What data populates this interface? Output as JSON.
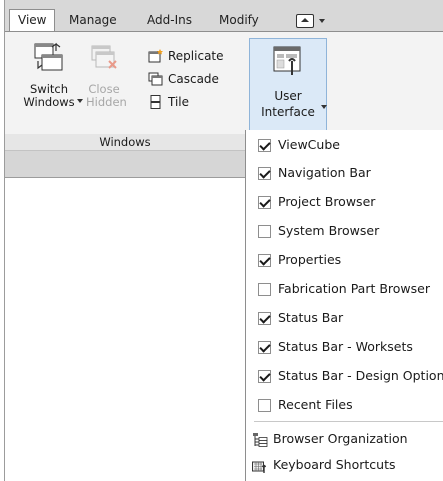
{
  "tabs": [
    {
      "label": "View",
      "active": true
    },
    {
      "label": "Manage",
      "active": false
    },
    {
      "label": "Add-Ins",
      "active": false
    },
    {
      "label": "Modify",
      "active": false
    }
  ],
  "windows_panel": {
    "title": "Windows",
    "switch_windows": {
      "line1": "Switch",
      "line2": "Windows",
      "icon": "switch-windows-icon",
      "has_dropdown": true
    },
    "close_hidden": {
      "line1": "Close",
      "line2": "Hidden",
      "icon": "close-hidden-icon",
      "enabled": false
    },
    "small_buttons": [
      {
        "label": "Replicate",
        "icon": "replicate-icon"
      },
      {
        "label": "Cascade",
        "icon": "cascade-icon"
      },
      {
        "label": "Tile",
        "icon": "tile-icon"
      }
    ]
  },
  "user_interface": {
    "line1": "User",
    "line2": "Interface",
    "icon": "user-interface-icon",
    "has_dropdown": true
  },
  "menu": {
    "toggles": [
      {
        "label": "ViewCube",
        "checked": true
      },
      {
        "label": "Navigation Bar",
        "checked": true
      },
      {
        "label": "Project Browser",
        "checked": true
      },
      {
        "label": "System Browser",
        "checked": false
      },
      {
        "label": "Properties",
        "checked": true
      },
      {
        "label": "Fabrication Part Browser",
        "checked": false
      },
      {
        "label": "Status Bar",
        "checked": true
      },
      {
        "label": "Status Bar - Worksets",
        "checked": true
      },
      {
        "label": "Status Bar - Design Options",
        "checked": true
      },
      {
        "label": "Recent Files",
        "checked": false
      }
    ],
    "commands": [
      {
        "label": "Browser Organization",
        "icon": "browser-organization-icon"
      },
      {
        "label": "Keyboard Shortcuts",
        "icon": "keyboard-shortcuts-icon"
      }
    ]
  },
  "colors": {
    "accent": "#dbe9f7",
    "accent_border": "#8fb4d9",
    "ribbon_bg": "#f3f3f3",
    "tabbar_bg": "#d8d8d8"
  }
}
